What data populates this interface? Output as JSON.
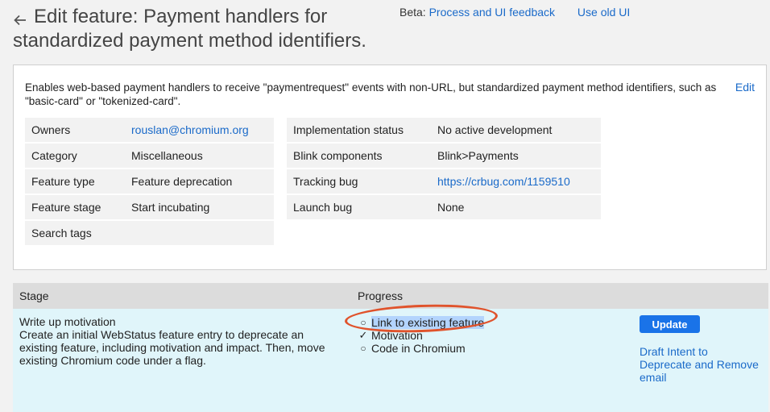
{
  "header": {
    "title": "Edit feature: Payment handlers for standardized payment method identifiers.",
    "beta_label": "Beta:",
    "beta_link": "Process and UI feedback",
    "old_ui_link": "Use old UI"
  },
  "summary": {
    "text": "Enables web-based payment handlers to receive \"paymentrequest\" events with non-URL, but standardized payment method identifiers, such as \"basic-card\" or \"tokenized-card\".",
    "edit_label": "Edit"
  },
  "metadata_left": [
    {
      "key": "Owners",
      "value": "rouslan@chromium.org"
    },
    {
      "key": "Category",
      "value": "Miscellaneous"
    },
    {
      "key": "Feature type",
      "value": "Feature deprecation"
    },
    {
      "key": "Feature stage",
      "value": "Start incubating"
    },
    {
      "key": "Search tags",
      "value": ""
    }
  ],
  "metadata_right": [
    {
      "key": "Implementation status",
      "value": "No active development"
    },
    {
      "key": "Blink components",
      "value": "Blink>Payments"
    },
    {
      "key": "Tracking bug",
      "value": "https://crbug.com/1159510"
    },
    {
      "key": "Launch bug",
      "value": "None"
    }
  ],
  "stages": {
    "headers": {
      "stage": "Stage",
      "progress": "Progress"
    },
    "row": {
      "title": "Write up motivation",
      "description": "Create an initial WebStatus feature entry to deprecate an existing feature, including motivation and impact. Then, move existing Chromium code under a flag.",
      "progress": [
        {
          "label": "Link to existing feature",
          "bullet": "○"
        },
        {
          "label": "Motivation",
          "bullet": "✓"
        },
        {
          "label": "Code in Chromium",
          "bullet": "○"
        }
      ],
      "update_label": "Update",
      "draft_link": "Draft Intent to Deprecate and Remove email"
    }
  },
  "colors": {
    "link": "#1a6ac9",
    "button": "#1a73e8",
    "annotation": "#e0532c",
    "stage_bg": "#e0f5fa"
  }
}
